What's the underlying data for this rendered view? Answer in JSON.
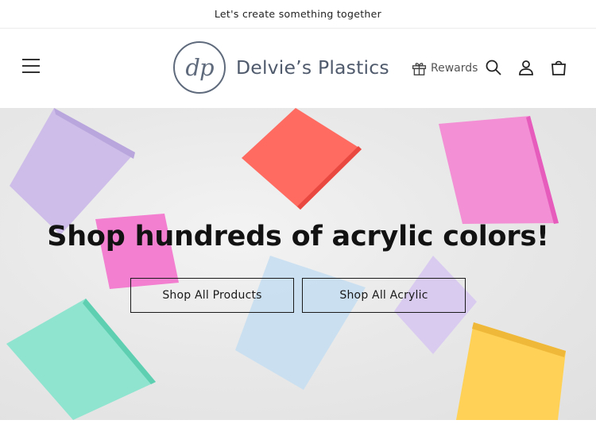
{
  "announcement": {
    "text": "Let's create something together"
  },
  "header": {
    "menu_icon": "hamburger-icon",
    "logo_mark": "dp",
    "logo_text": "Delvie’s Plastics",
    "rewards_label": "Rewards",
    "rewards_icon": "gift-icon",
    "icons": [
      "search-icon",
      "account-icon",
      "cart-icon"
    ],
    "logo_color": "#5f6b7d"
  },
  "hero": {
    "title": "Shop hundreds of acrylic colors!",
    "buttons": [
      {
        "label": "Shop All Products"
      },
      {
        "label": "Shop All Acrylic"
      }
    ],
    "shard_colors": {
      "lavender": "#cbbbe8",
      "coral": "#ff6b61",
      "pink": "#f38fd4",
      "mint": "#8fe4cf",
      "sky": "#c8dff0",
      "yellow": "#ffd257"
    }
  }
}
